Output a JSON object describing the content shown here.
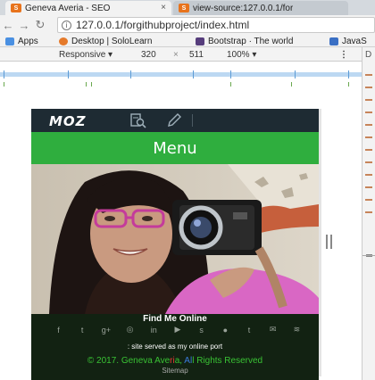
{
  "browser": {
    "tabs": [
      {
        "title": "Geneva Averia - SEO",
        "favicon": "S"
      },
      {
        "title": "view-source:127.0.0.1/for",
        "favicon": "S"
      }
    ],
    "url": "127.0.0.1/forgithubproject/index.html",
    "bookmarks": [
      {
        "label": "Apps",
        "icon": "apps-icon",
        "color": "#4a90e2"
      },
      {
        "label": "Desktop | SoloLearn",
        "icon": "sololearn-icon",
        "color": "#e57a2b"
      },
      {
        "label": "Bootstrap · The world",
        "icon": "bootstrap-icon",
        "color": "#563d7c"
      },
      {
        "label": "JavaS",
        "icon": "mb-icon",
        "color": "#3a6fc4"
      }
    ]
  },
  "devtools": {
    "device": "Responsive",
    "width": "320",
    "times": "×",
    "height": "511",
    "zoom": "100%"
  },
  "page": {
    "logo": "MOZ",
    "menu_label": "Menu",
    "find_title": "Find Me Online",
    "social_icons": [
      "facebook-icon",
      "twitter-icon",
      "google-plus-icon",
      "instagram-icon",
      "linkedin-icon",
      "youtube-icon",
      "skype-icon",
      "github-icon",
      "tumblr-icon",
      "email-icon",
      "rss-icon"
    ],
    "tagline": ": site served as my online port",
    "copyright": {
      "prefix": "© 2017. Geneva Ave",
      "red": "ri",
      "mid": "a, ",
      "blue": "Al",
      "suffix": "l Rights Reserved"
    },
    "sitemap": "Sitemap"
  },
  "colors": {
    "menu_green": "#2fae3e",
    "header_dark": "#1e2b33",
    "footer_dark": "#122212"
  }
}
